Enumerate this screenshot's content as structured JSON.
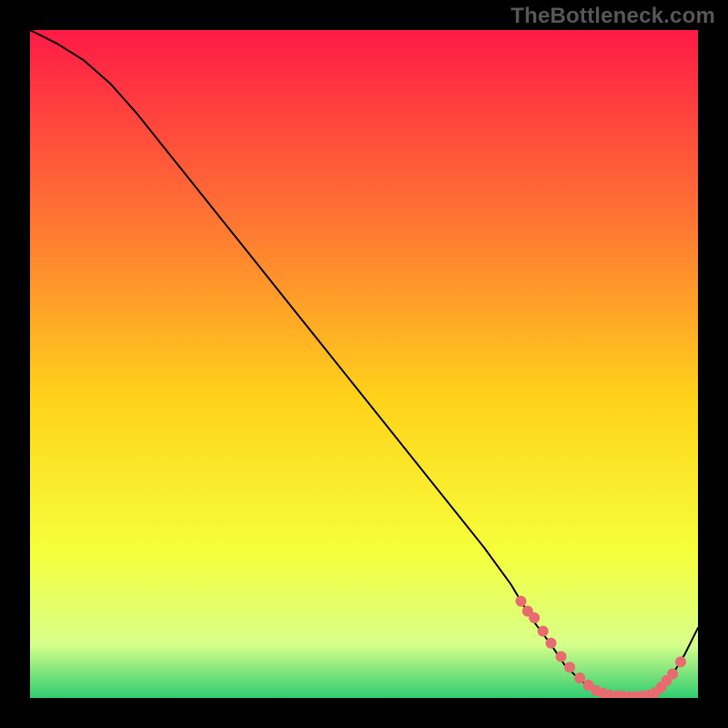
{
  "watermark": "TheBottleneck.com",
  "chart_data": {
    "type": "line",
    "title": "",
    "xlabel": "",
    "ylabel": "",
    "xlim": [
      0,
      100
    ],
    "ylim": [
      0,
      100
    ],
    "grid": false,
    "legend": false,
    "background_gradient": {
      "top_color": "#ff1a46",
      "mid_upper_color": "#ff7a32",
      "mid_color": "#ffd21a",
      "mid_lower_color": "#f6ff3a",
      "near_bottom_color": "#d7ff8a",
      "bottom_color": "#2ecc71"
    },
    "series": [
      {
        "name": "bottleneck-curve",
        "color": "#000000",
        "x": [
          0,
          4,
          8,
          12,
          16,
          20,
          24,
          28,
          32,
          36,
          40,
          44,
          48,
          52,
          56,
          60,
          64,
          68,
          72,
          75,
          78,
          80,
          82,
          84,
          86,
          88,
          90,
          92,
          94,
          96,
          98,
          100
        ],
        "y": [
          100,
          98,
          95.5,
          92,
          87.5,
          82.5,
          77.5,
          72.5,
          67.5,
          62.5,
          57.5,
          52.5,
          47.5,
          42.5,
          37.5,
          32.5,
          27.5,
          22.5,
          17,
          12,
          8,
          5,
          3,
          1.5,
          0.7,
          0.3,
          0.2,
          0.3,
          1.2,
          3.2,
          6.5,
          10.5
        ]
      }
    ],
    "marker_points": {
      "name": "highlighted-points",
      "color": "#e86b6f",
      "x": [
        73.5,
        74.5,
        75.5,
        76.8,
        78,
        79.5,
        80.8,
        82.3,
        83.6,
        84.8,
        85.8,
        86.7,
        87.8,
        88.7,
        89.7,
        90.8,
        91.6,
        92.6,
        93.6,
        94.5,
        95.3,
        96.2,
        97.4
      ],
      "y": [
        14.5,
        13,
        12,
        10,
        8.2,
        6.2,
        4.6,
        3,
        1.9,
        1.1,
        0.7,
        0.45,
        0.3,
        0.25,
        0.22,
        0.22,
        0.28,
        0.4,
        0.8,
        1.6,
        2.6,
        3.6,
        5.4
      ]
    }
  }
}
